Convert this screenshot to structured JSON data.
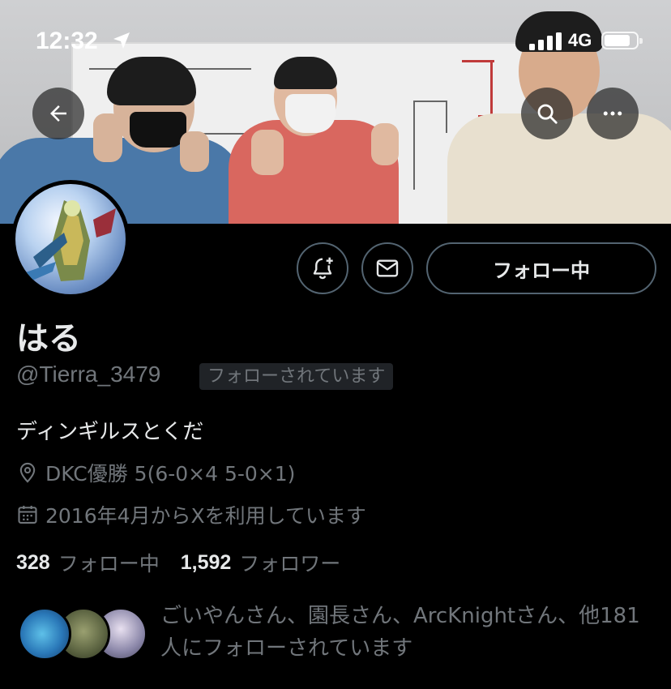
{
  "status_bar": {
    "time": "12:32",
    "network": "4G"
  },
  "icons": {
    "back": "arrow-left-icon",
    "search": "search-icon",
    "more": "more-horizontal-icon",
    "notify": "bell-plus-icon",
    "message": "mail-icon",
    "location": "location-pin-icon",
    "calendar": "calendar-icon"
  },
  "profile": {
    "display_name": "はる",
    "handle": "@Tierra_3479",
    "follows_you_badge": "フォローされています",
    "bio": "ディンギルスとくだ",
    "location": "DKC優勝 5(6-0×4 5-0×1)",
    "joined": "2016年4月からXを利用しています"
  },
  "actions": {
    "follow_label": "フォロー中"
  },
  "stats": {
    "following_count": "328",
    "following_label": "フォロー中",
    "followers_count": "1,592",
    "followers_label": "フォロワー"
  },
  "followed_by": {
    "text": "ごいやんさん、園長さん、ArcKnightさん、他181人にフォローされています"
  },
  "colors": {
    "background": "#000000",
    "primary_text": "#e7e9ea",
    "secondary_text": "#71767b",
    "border": "#536471",
    "badge_bg": "#202327"
  }
}
